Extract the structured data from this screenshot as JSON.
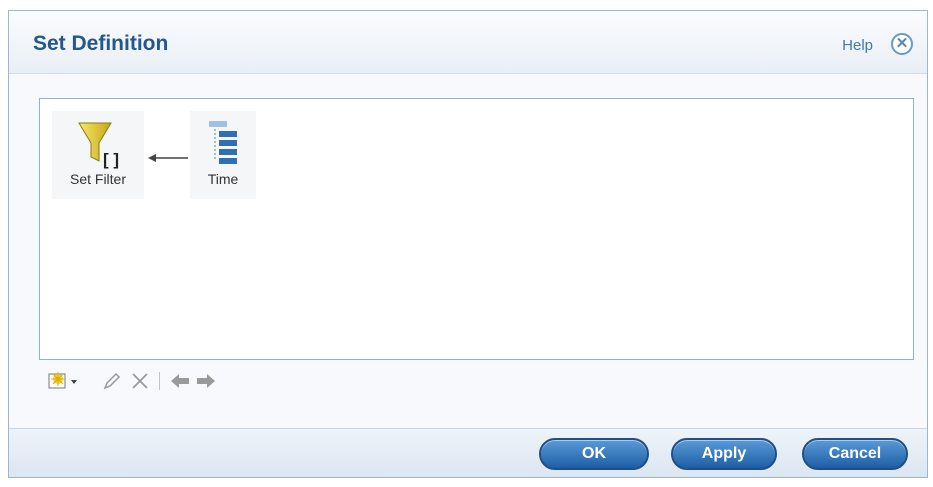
{
  "dialog": {
    "title": "Set Definition",
    "help_label": "Help",
    "close_icon": "close-circle-icon"
  },
  "canvas": {
    "nodes": [
      {
        "label": "Set Filter",
        "icon": "funnel-filter-icon"
      },
      {
        "label": "Time",
        "icon": "hierarchy-dimension-icon"
      }
    ]
  },
  "toolbar": {
    "items": [
      {
        "icon": "new-item-icon",
        "has_dropdown": true
      },
      {
        "icon": "edit-pencil-icon"
      },
      {
        "icon": "delete-x-icon"
      },
      {
        "icon": "arrow-left-icon"
      },
      {
        "icon": "arrow-right-icon"
      }
    ]
  },
  "footer": {
    "ok_label": "OK",
    "apply_label": "Apply",
    "cancel_label": "Cancel"
  },
  "colors": {
    "title": "#24578a",
    "button": "#1d5fa6",
    "canvas_border": "#8eb2d4"
  }
}
